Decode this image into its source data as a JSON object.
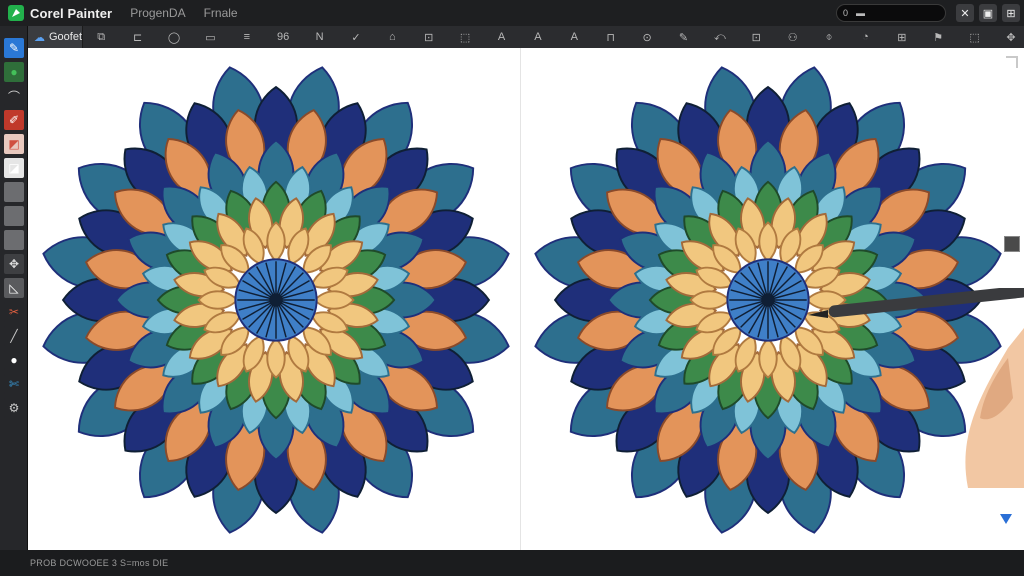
{
  "app": {
    "title": "Corel Painter",
    "menu": [
      "ProgenDA",
      "Frnale"
    ]
  },
  "search": {
    "label": "0",
    "icon": "search-icon"
  },
  "window_controls": [
    {
      "name": "minimize-icon",
      "glyph": "✕"
    },
    {
      "name": "save-icon",
      "glyph": "▣"
    },
    {
      "name": "close-icon",
      "glyph": "⊞"
    }
  ],
  "toolbar": {
    "doc_tab": "Goofet",
    "icons": [
      "⧉",
      "⊏",
      "◯",
      "▭",
      "≡",
      "96",
      "N",
      "✓",
      "⌂",
      "⊡",
      "⬚",
      "A",
      "A",
      "A",
      "⊓",
      "⊙",
      "✎",
      "⤺",
      "⊡",
      "⚇",
      "⌽",
      "◔",
      "⊞",
      "⚑",
      "⬚",
      "✥"
    ]
  },
  "tools": [
    {
      "name": "brush-tool-icon",
      "glyph": "✎",
      "bg": "#2a78d6",
      "color": "#ffffff"
    },
    {
      "name": "color-circle-icon",
      "glyph": "●",
      "bg": "#2f6e3a",
      "color": "#44c05a"
    },
    {
      "name": "smudge-tool-icon",
      "glyph": "⌒",
      "bg": "#26272a",
      "color": "#cccccc"
    },
    {
      "name": "dropper-tool-icon",
      "glyph": "✐",
      "bg": "#c0392b",
      "color": "#ffffff"
    },
    {
      "name": "paper-swatch-icon",
      "glyph": "◩",
      "bg": "#e8c9bf",
      "color": "#d05040"
    },
    {
      "name": "gradient-swatch-icon",
      "glyph": "◪",
      "bg": "#e6e6e6",
      "color": "#ffffff"
    },
    {
      "name": "layer-icon",
      "glyph": "",
      "bg": "#6c6d70",
      "color": "#cccccc"
    },
    {
      "name": "layer-icon",
      "glyph": "",
      "bg": "#6c6d70",
      "color": "#cccccc"
    },
    {
      "name": "layer-icon",
      "glyph": "",
      "bg": "#6c6d70",
      "color": "#cccccc"
    },
    {
      "name": "transform-tool-icon",
      "glyph": "✥",
      "bg": "#3e3f42",
      "color": "#dddddd"
    },
    {
      "name": "crop-tool-icon",
      "glyph": "◺",
      "bg": "#5a5b5e",
      "color": "#ffffff"
    },
    {
      "name": "eraser-tool-icon",
      "glyph": "✂",
      "bg": "#26272a",
      "color": "#e06040"
    },
    {
      "name": "pen-tool-icon",
      "glyph": "╱",
      "bg": "#26272a",
      "color": "#cccccc"
    },
    {
      "name": "main-color-icon",
      "glyph": "●",
      "bg": "#26272a",
      "color": "#ffffff"
    },
    {
      "name": "scissors-tool-icon",
      "glyph": "✄",
      "bg": "#26272a",
      "color": "#3aa0e0"
    },
    {
      "name": "settings-tool-icon",
      "glyph": "⚙",
      "bg": "#26272a",
      "color": "#cccccc"
    }
  ],
  "status": {
    "text": "PROB DCWOOEE 3 S=mos DIE"
  },
  "palette": {
    "navy": "#1f2f7a",
    "teal": "#2d6f8e",
    "sky": "#7fc3d8",
    "orange": "#e3945a",
    "tan": "#f1c77f",
    "green": "#3d8a4a",
    "dark": "#0f1f35"
  }
}
